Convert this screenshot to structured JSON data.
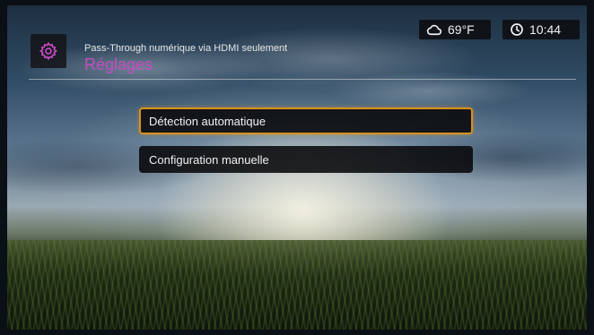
{
  "header": {
    "subtitle": "Pass-Through numérique via HDMI seulement",
    "title": "Réglages",
    "icon": "gear-icon",
    "title_color": "#c84bc4"
  },
  "status": {
    "weather_icon": "cloud-icon",
    "temperature": "69°F",
    "clock_icon": "clock-icon",
    "time": "10:44"
  },
  "menu": {
    "items": [
      {
        "label": "Détection automatique",
        "focused": true
      },
      {
        "label": "Configuration manuelle",
        "focused": false
      }
    ],
    "focus_color": "#d7921f"
  }
}
